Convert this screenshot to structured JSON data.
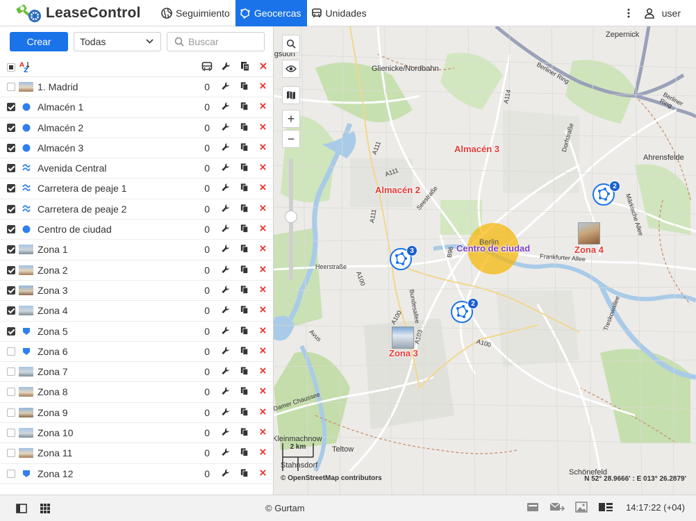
{
  "app": {
    "brand": "LeaseControl",
    "user": "user"
  },
  "nav": [
    {
      "label": "Seguimiento",
      "icon": "globe-icon",
      "active": false
    },
    {
      "label": "Geocercas",
      "icon": "geofence-icon",
      "active": true
    },
    {
      "label": "Unidades",
      "icon": "bus-icon",
      "active": false
    }
  ],
  "toolbar": {
    "create_label": "Crear",
    "filter_value": "Todas",
    "search_placeholder": "Buscar"
  },
  "list_header": {
    "sort_icon": "sort-az-icon",
    "columns": [
      "bus-icon",
      "wrench-icon",
      "copy-icon",
      "delete-icon"
    ]
  },
  "geofences": [
    {
      "name": "1. Madrid",
      "count": "0",
      "checked": false,
      "kind": "photo"
    },
    {
      "name": "Almacén 1",
      "count": "0",
      "checked": true,
      "kind": "circle"
    },
    {
      "name": "Almacén 2",
      "count": "0",
      "checked": true,
      "kind": "circle"
    },
    {
      "name": "Almacén 3",
      "count": "0",
      "checked": true,
      "kind": "circle"
    },
    {
      "name": "Avenida Central",
      "count": "0",
      "checked": true,
      "kind": "line"
    },
    {
      "name": "Carretera de peaje 1",
      "count": "0",
      "checked": true,
      "kind": "line"
    },
    {
      "name": "Carretera de peaje 2",
      "count": "0",
      "checked": true,
      "kind": "line"
    },
    {
      "name": "Centro de ciudad",
      "count": "0",
      "checked": true,
      "kind": "circle"
    },
    {
      "name": "Zona 1",
      "count": "0",
      "checked": true,
      "kind": "photo"
    },
    {
      "name": "Zona 2",
      "count": "0",
      "checked": true,
      "kind": "photo"
    },
    {
      "name": "Zona 3",
      "count": "0",
      "checked": true,
      "kind": "photo"
    },
    {
      "name": "Zona 4",
      "count": "0",
      "checked": true,
      "kind": "photo"
    },
    {
      "name": "Zona 5",
      "count": "0",
      "checked": true,
      "kind": "polygon"
    },
    {
      "name": "Zona 6",
      "count": "0",
      "checked": false,
      "kind": "polygon"
    },
    {
      "name": "Zona 7",
      "count": "0",
      "checked": false,
      "kind": "photo"
    },
    {
      "name": "Zona 8",
      "count": "0",
      "checked": false,
      "kind": "photo"
    },
    {
      "name": "Zona 9",
      "count": "0",
      "checked": false,
      "kind": "photo"
    },
    {
      "name": "Zona 10",
      "count": "0",
      "checked": false,
      "kind": "photo"
    },
    {
      "name": "Zona 11",
      "count": "0",
      "checked": false,
      "kind": "photo"
    },
    {
      "name": "Zona 12",
      "count": "0",
      "checked": false,
      "kind": "polygon"
    }
  ],
  "map": {
    "labels": {
      "almacen3": "Almacén 3",
      "almacen2": "Almacén 2",
      "centro": "Centro de ciudad",
      "zona4": "Zona 4",
      "zona3": "Zona 3"
    },
    "places": {
      "zepernick": "Zepernick",
      "glienicke": "Glienicke/Nordbahn",
      "ahrensfelde": "Ahrensfelde",
      "berlin": "Berlin",
      "teltow": "Teltow",
      "schonefeld": "Schönefeld",
      "kleinmachnow": "Kleinmachnow",
      "stahnsdorf": "Stahnsdorf",
      "hennigsdorf": "Hennigsdorf",
      "berliner_ring": "Berliner Ring",
      "frankfurter_allee": "Frankfurter Allee",
      "heerstrasse": "Heerstraße",
      "seestrasse": "Seestraße",
      "bundesallee": "Bundesallee",
      "dorfstrasse": "Dorfstraße",
      "markische_allee": "Märkische Allee",
      "treskowallee": "Treskowallee",
      "damer_chaussee": "Damer Chaussee",
      "a111": "A111",
      "a114": "A114",
      "a100": "A100",
      "a103": "A103",
      "b96": "B96",
      "avus": "Avus"
    },
    "clusters": [
      {
        "count": "3"
      },
      {
        "count": "2"
      },
      {
        "count": "2"
      }
    ],
    "scale": "2 km",
    "attribution": "© OpenStreetMap contributors",
    "coords": "N 52° 28.9666' : E 013° 26.2879'"
  },
  "colors": {
    "accent": "#1a73e8",
    "delete": "#e53935",
    "label_red": "#e53935",
    "label_purple": "#7b3fc1",
    "geofence_circle": "#f5b800"
  },
  "footer": {
    "copyright": "© Gurtam",
    "time": "14:17:22 (+04)"
  }
}
